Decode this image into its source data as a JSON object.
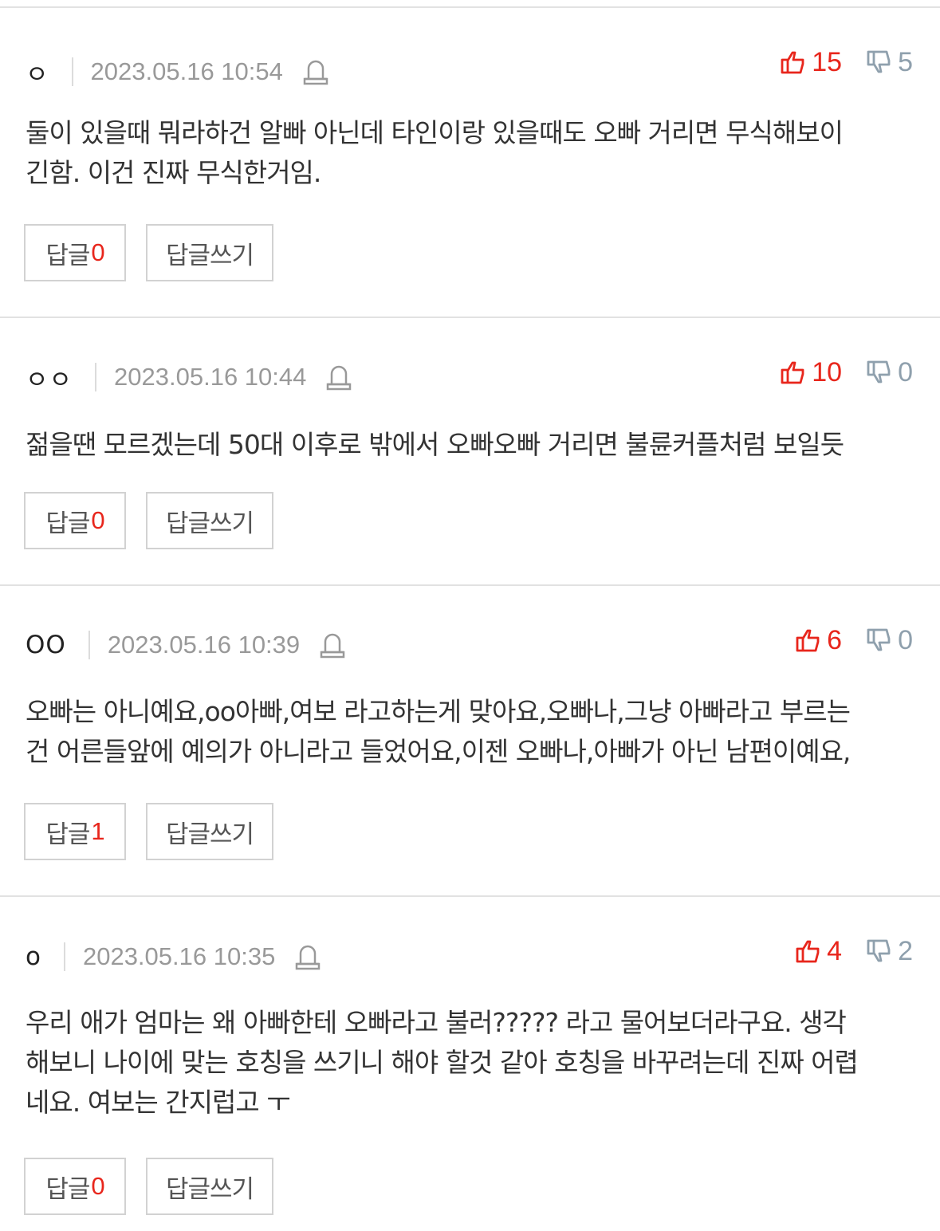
{
  "labels": {
    "reply": "답글",
    "write_reply": "답글쓰기"
  },
  "colors": {
    "accent_red": "#e8261c",
    "muted_gray": "#999999",
    "border": "#d2d2d2"
  },
  "icons": {
    "report": "siren-icon",
    "like": "thumbs-up-icon",
    "dislike": "thumbs-down-icon"
  },
  "comments": [
    {
      "author": "ㅇ",
      "date": "2023.05.16 10:54",
      "likes": "15",
      "dislikes": "5",
      "text_lines": [
        "둘이 있을때 뭐라하건 알빠 아닌데 타인이랑 있을때도 오빠 거리면 무식해보이",
        "긴함. 이건 진짜 무식한거임."
      ],
      "reply_count": "0"
    },
    {
      "author": "ㅇㅇ",
      "date": "2023.05.16 10:44",
      "likes": "10",
      "dislikes": "0",
      "text_lines": [
        "젊을땐 모르겠는데 50대 이후로 밖에서 오빠오빠 거리면 불륜커플처럼 보일듯"
      ],
      "reply_count": "0"
    },
    {
      "author": "OO",
      "date": "2023.05.16 10:39",
      "likes": "6",
      "dislikes": "0",
      "text_lines": [
        "오빠는 아니예요,oo아빠,여보 라고하는게 맞아요,오빠나,그냥 아빠라고 부르는",
        "건 어른들앞에 예의가 아니라고 들었어요,이젠 오빠나,아빠가 아닌 남편이예요,"
      ],
      "reply_count": "1"
    },
    {
      "author": "o",
      "date": "2023.05.16 10:35",
      "likes": "4",
      "dislikes": "2",
      "text_lines": [
        "우리 애가 엄마는 왜 아빠한테 오빠라고 불러????? 라고 물어보더라구요. 생각",
        "해보니 나이에 맞는 호칭을 쓰기니 해야 할것 같아 호칭을 바꾸려는데 진짜 어렵",
        "네요. 여보는 간지럽고 ㅜ"
      ],
      "reply_count": "0"
    }
  ]
}
